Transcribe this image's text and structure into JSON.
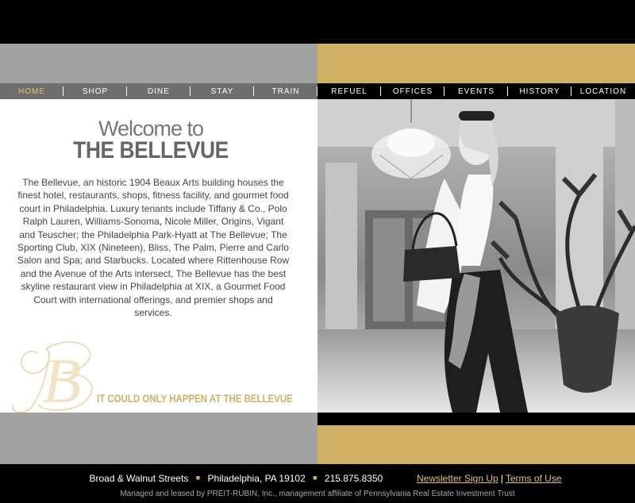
{
  "nav": {
    "items": [
      {
        "label": "HOME"
      },
      {
        "label": "SHOP"
      },
      {
        "label": "DINE"
      },
      {
        "label": "STAY"
      },
      {
        "label": "TRAIN"
      },
      {
        "label": "REFUEL"
      },
      {
        "label": "OFFICES"
      },
      {
        "label": "EVENTS"
      },
      {
        "label": "HISTORY"
      },
      {
        "label": "LOCATION"
      }
    ],
    "active": "HOME"
  },
  "welcome": {
    "line1": "Welcome to",
    "line2": "THE BELLEVUE"
  },
  "intro_text": "The Bellevue, an historic 1904 Beaux Arts building houses the finest hotel, restaurants, shops, fitness facility, and gourmet food court in Philadelphia. Luxury tenants include Tiffany & Co., Polo Ralph Lauren, Williams-Sonoma, Nicole Miller, Origins, Vigant and Teuscher; the Philadelphia Park-Hyatt at The Bellevue; The Sporting Club, XIX (Nineteen), Bliss, The Palm, Pierre and Carlo Salon and Spa; and Starbucks. Located where Rittenhouse Row and the Avenue of the Arts intersect, The Bellevue has the best skyline restaurant view in Philadelphia at XIX, a Gourmet Food Court with international offerings, and premier shops and services.",
  "logo_letter": "B",
  "tagline": "IT COULD ONLY HAPPEN AT THE BELLEVUE",
  "footer": {
    "address_street": "Broad & Walnut Streets",
    "address_city": "Philadelphia, PA 19102",
    "phone": "215.875.8350",
    "newsletter_label": "Newsletter Sign Up",
    "separator": "|",
    "terms_label": "Terms of Use",
    "managed_by": "Managed and leased by PREIT-RUBIN, Inc., management affiliate of Pennsylvania Real Estate Investment Trust"
  },
  "colors": {
    "gold": "#d0b064",
    "grey": "#a2a2a2",
    "nav_grey": "#6e6e6e",
    "active_nav": "#e0c07a"
  }
}
